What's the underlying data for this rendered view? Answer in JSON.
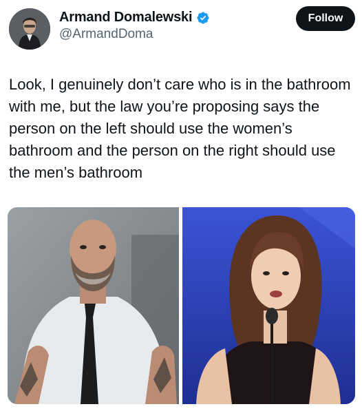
{
  "author": {
    "display_name": "Armand Domalewski",
    "handle": "@ArmandDoma",
    "verified": true,
    "verified_color": "#1d9bf0"
  },
  "actions": {
    "follow_label": "Follow"
  },
  "tweet": {
    "text": "Look, I genuinely don’t care who is in the bathroom with me, but the law you’re proposing says the person on the left should use the women’s bathroom and the person on the right should use the men’s bathroom"
  },
  "media": {
    "images": [
      {
        "icon": "photo-bearded-tattooed-man"
      },
      {
        "icon": "photo-woman-at-podium"
      }
    ]
  },
  "colors": {
    "text_primary": "#0f1419",
    "text_secondary": "#536471",
    "button_bg": "#0f1419",
    "button_text": "#ffffff"
  }
}
